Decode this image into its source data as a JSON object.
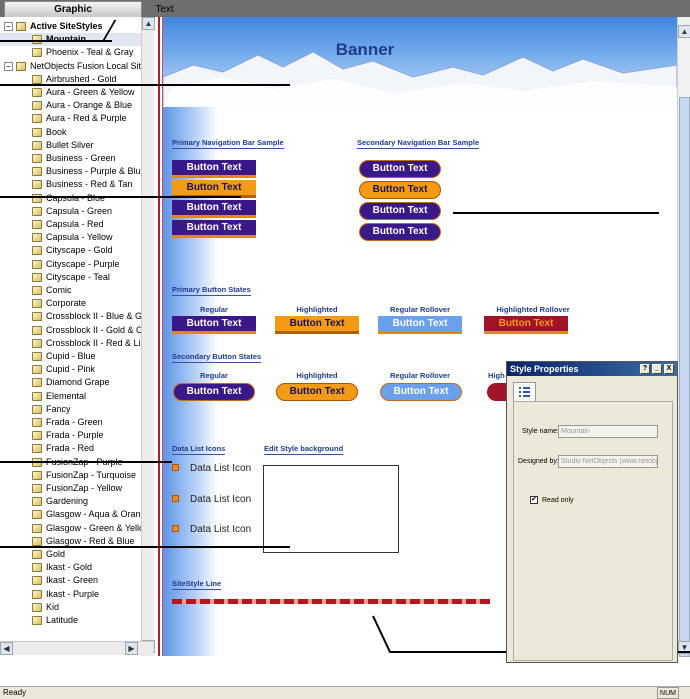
{
  "tabs": [
    {
      "label": "Graphic"
    },
    {
      "label": "Text"
    }
  ],
  "tree": {
    "active_group": "Active SiteStyles",
    "active_styles": [
      "Mountain",
      "Phoenix - Teal & Gray"
    ],
    "local_group": "NetObjects Fusion Local SiteSty",
    "local_styles": [
      "Airbrushed - Gold",
      "Aura - Green & Yellow",
      "Aura - Orange & Blue",
      "Aura - Red & Purple",
      "Book",
      "Bullet Silver",
      "Business - Green",
      "Business - Purple & Blue",
      "Business - Red & Tan",
      "Capsula - Blue",
      "Capsula - Green",
      "Capsula - Red",
      "Capsula - Yellow",
      "Cityscape - Gold",
      "Cityscape - Purple",
      "Cityscape - Teal",
      "Comic",
      "Corporate",
      "Crossblock II - Blue & Green",
      "Crossblock II - Gold & Crims",
      "Crossblock II - Red & Lilac",
      "Cupid - Blue",
      "Cupid - Pink",
      "Diamond Grape",
      "Elemental",
      "Fancy",
      "Frada - Green",
      "Frada - Purple",
      "Frada - Red",
      "FusionZap - Purple",
      "FusionZap - Turquoise",
      "FusionZap - Yellow",
      "Gardening",
      "Glasgow - Aqua & Orange",
      "Glasgow - Green & Yellow",
      "Glasgow - Red & Blue",
      "Gold",
      "Ikast - Gold",
      "Ikast - Green",
      "Ikast - Purple",
      "Kid",
      "Latitude"
    ]
  },
  "preview": {
    "banner_title": "Banner",
    "primary_nav_heading": "Primary Navigation Bar Sample",
    "secondary_nav_heading": "Secondary Navigation Bar Sample",
    "button_text": "Button Text",
    "primary_states_heading": "Primary Button States",
    "secondary_states_heading": "Secondary Button States",
    "state_regular": "Regular",
    "state_highlighted": "Highlighted",
    "state_regular_rollover": "Regular Rollover",
    "state_highlighted_rollover": "Highlighted Rollover",
    "state_highlighted_truncated": "High",
    "data_list_heading": "Data List Icons",
    "data_list_label": "Data List Icon",
    "edit_bg_heading": "Edit Style background",
    "sitestyle_line_heading": "SiteStyle Line"
  },
  "dialog": {
    "title": "Style Properties",
    "help": "?",
    "minimize": "_",
    "close": "X",
    "style_name_label": "Style name:",
    "style_name_value": "Mountain",
    "designed_by_label": "Designed by:",
    "designed_by_value": "Studio NetObjects (www.netobjects.",
    "read_only_label": "Read only",
    "read_only_checked": "✔"
  },
  "status": {
    "text": "Ready",
    "num": "NUM"
  },
  "colors": {
    "nav_regular": "#3a1888",
    "nav_highlight": "#f39a16",
    "rollover": "#6aa0ec",
    "highlight_rollover": "#a0142a",
    "banner_sky": "#3e86e0"
  }
}
